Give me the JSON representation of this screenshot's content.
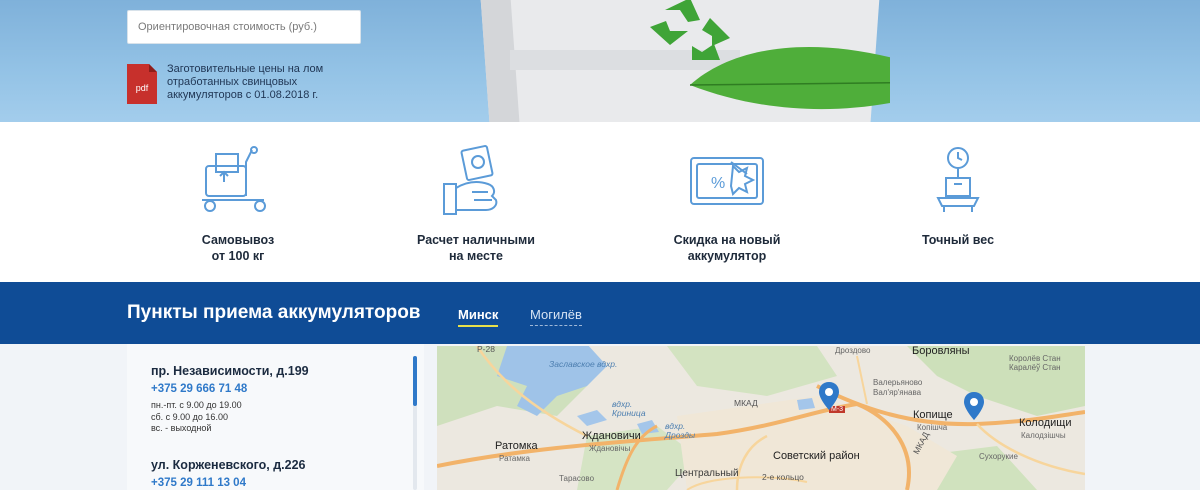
{
  "hero": {
    "cost_placeholder": "Ориентировочная стоимость (руб.)",
    "pdf_icon_text": "pdf",
    "pdf_link_text": "Заготовительные цены на лом отработанных свинцовых аккумуляторов с 01.08.2018 г."
  },
  "features": [
    {
      "icon": "forklift-cart-icon",
      "label": "Самовывоз\nот 100 кг"
    },
    {
      "icon": "cash-hand-icon",
      "label": "Расчет наличными\nна месте"
    },
    {
      "icon": "discount-ticket-icon",
      "label": "Скидка на новый\nаккумулятор"
    },
    {
      "icon": "scale-weight-icon",
      "label": "Точный вес"
    }
  ],
  "points": {
    "title": "Пункты приема аккумуляторов",
    "tabs": [
      {
        "label": "Минск",
        "active": true
      },
      {
        "label": "Могилёв",
        "active": false
      }
    ],
    "locations": [
      {
        "address": "пр. Независимости, д.199",
        "phone": "+375 29 666 71 48",
        "hours": [
          "пн.-пт. с 9.00 до 19.00",
          "сб. с 9.00 до 16.00",
          "вс. - выходной"
        ]
      },
      {
        "address": "ул. Корженевского, д.226",
        "phone": "+375 29 111 13 04"
      }
    ]
  },
  "map": {
    "labels": {
      "drozdovo": "Дроздово",
      "borovlyany": "Боровляны",
      "korolev_stan": "Королёв Стан",
      "karalyou_stan": "Каралёў Стан",
      "zaslavskoe": "Заславское вдхр.",
      "valeryanovo": "Валерьяново",
      "valer_small": "Вал'яр'янава",
      "mkad": "МКАД",
      "mkad2": "МКАД",
      "m3": "М-3",
      "kopishche": "Копище",
      "kopishcha": "Копішча",
      "kolodishchi": "Колодищи",
      "kalodzishchy": "Калодзішчы",
      "vdhr_krinitsa": "вдхр.\nКриница",
      "vdhr_drozdy": "вдхр.\nДрозды",
      "ratomka": "Ратомка",
      "ratomka_by": "Ратамка",
      "zhdanovichi": "Ждановичи",
      "zhdanovichy": "Ждановічы",
      "sovetsky": "Советский район",
      "sukharukie": "Сухорукие",
      "tarasovo": "Тарасово",
      "tsentralny": "Центральный",
      "ring": "2-е кольцо",
      "r28": "Р-28"
    }
  },
  "colors": {
    "band": "#0f4c96",
    "accent_blue": "#2f79c9",
    "active_underline": "#e7e04a",
    "icon_stroke": "#5b9bd8"
  }
}
